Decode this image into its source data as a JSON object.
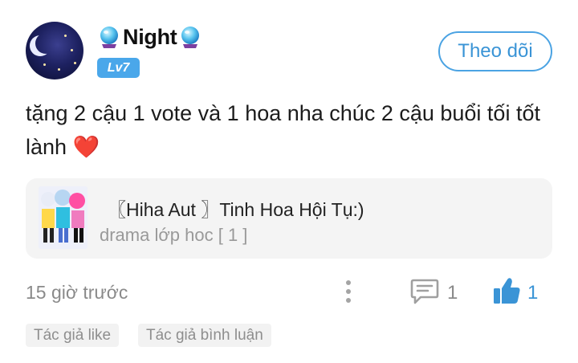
{
  "author": {
    "name": "Night",
    "level_badge": "Lv7",
    "name_decoration_icon": "crystal-ball-icon",
    "avatar_icon": "night-moon-avatar"
  },
  "follow_button": {
    "label": "Theo dõi"
  },
  "post": {
    "text": "tặng 2 cậu 1 vote và 1 hoa nha chúc 2 cậu buổi tối tốt lành",
    "emoji": "❤️"
  },
  "referenced_post": {
    "title": "〖Hiha Aut 〗Tinh Hoa Hội Tụ:)",
    "subtitle": "drama lớp hoc [ 1 ]"
  },
  "meta": {
    "timestamp": "15 giờ trước",
    "comment_count": "1",
    "like_count": "1"
  },
  "tags": [
    {
      "label": "Tác giả like"
    },
    {
      "label": "Tác giả bình luận"
    }
  ],
  "colors": {
    "accent": "#3a94d6",
    "badge": "#4aa7ea",
    "heart": "#d9232b",
    "card_bg": "#f4f4f4",
    "muted_text": "#8a8a8a"
  }
}
